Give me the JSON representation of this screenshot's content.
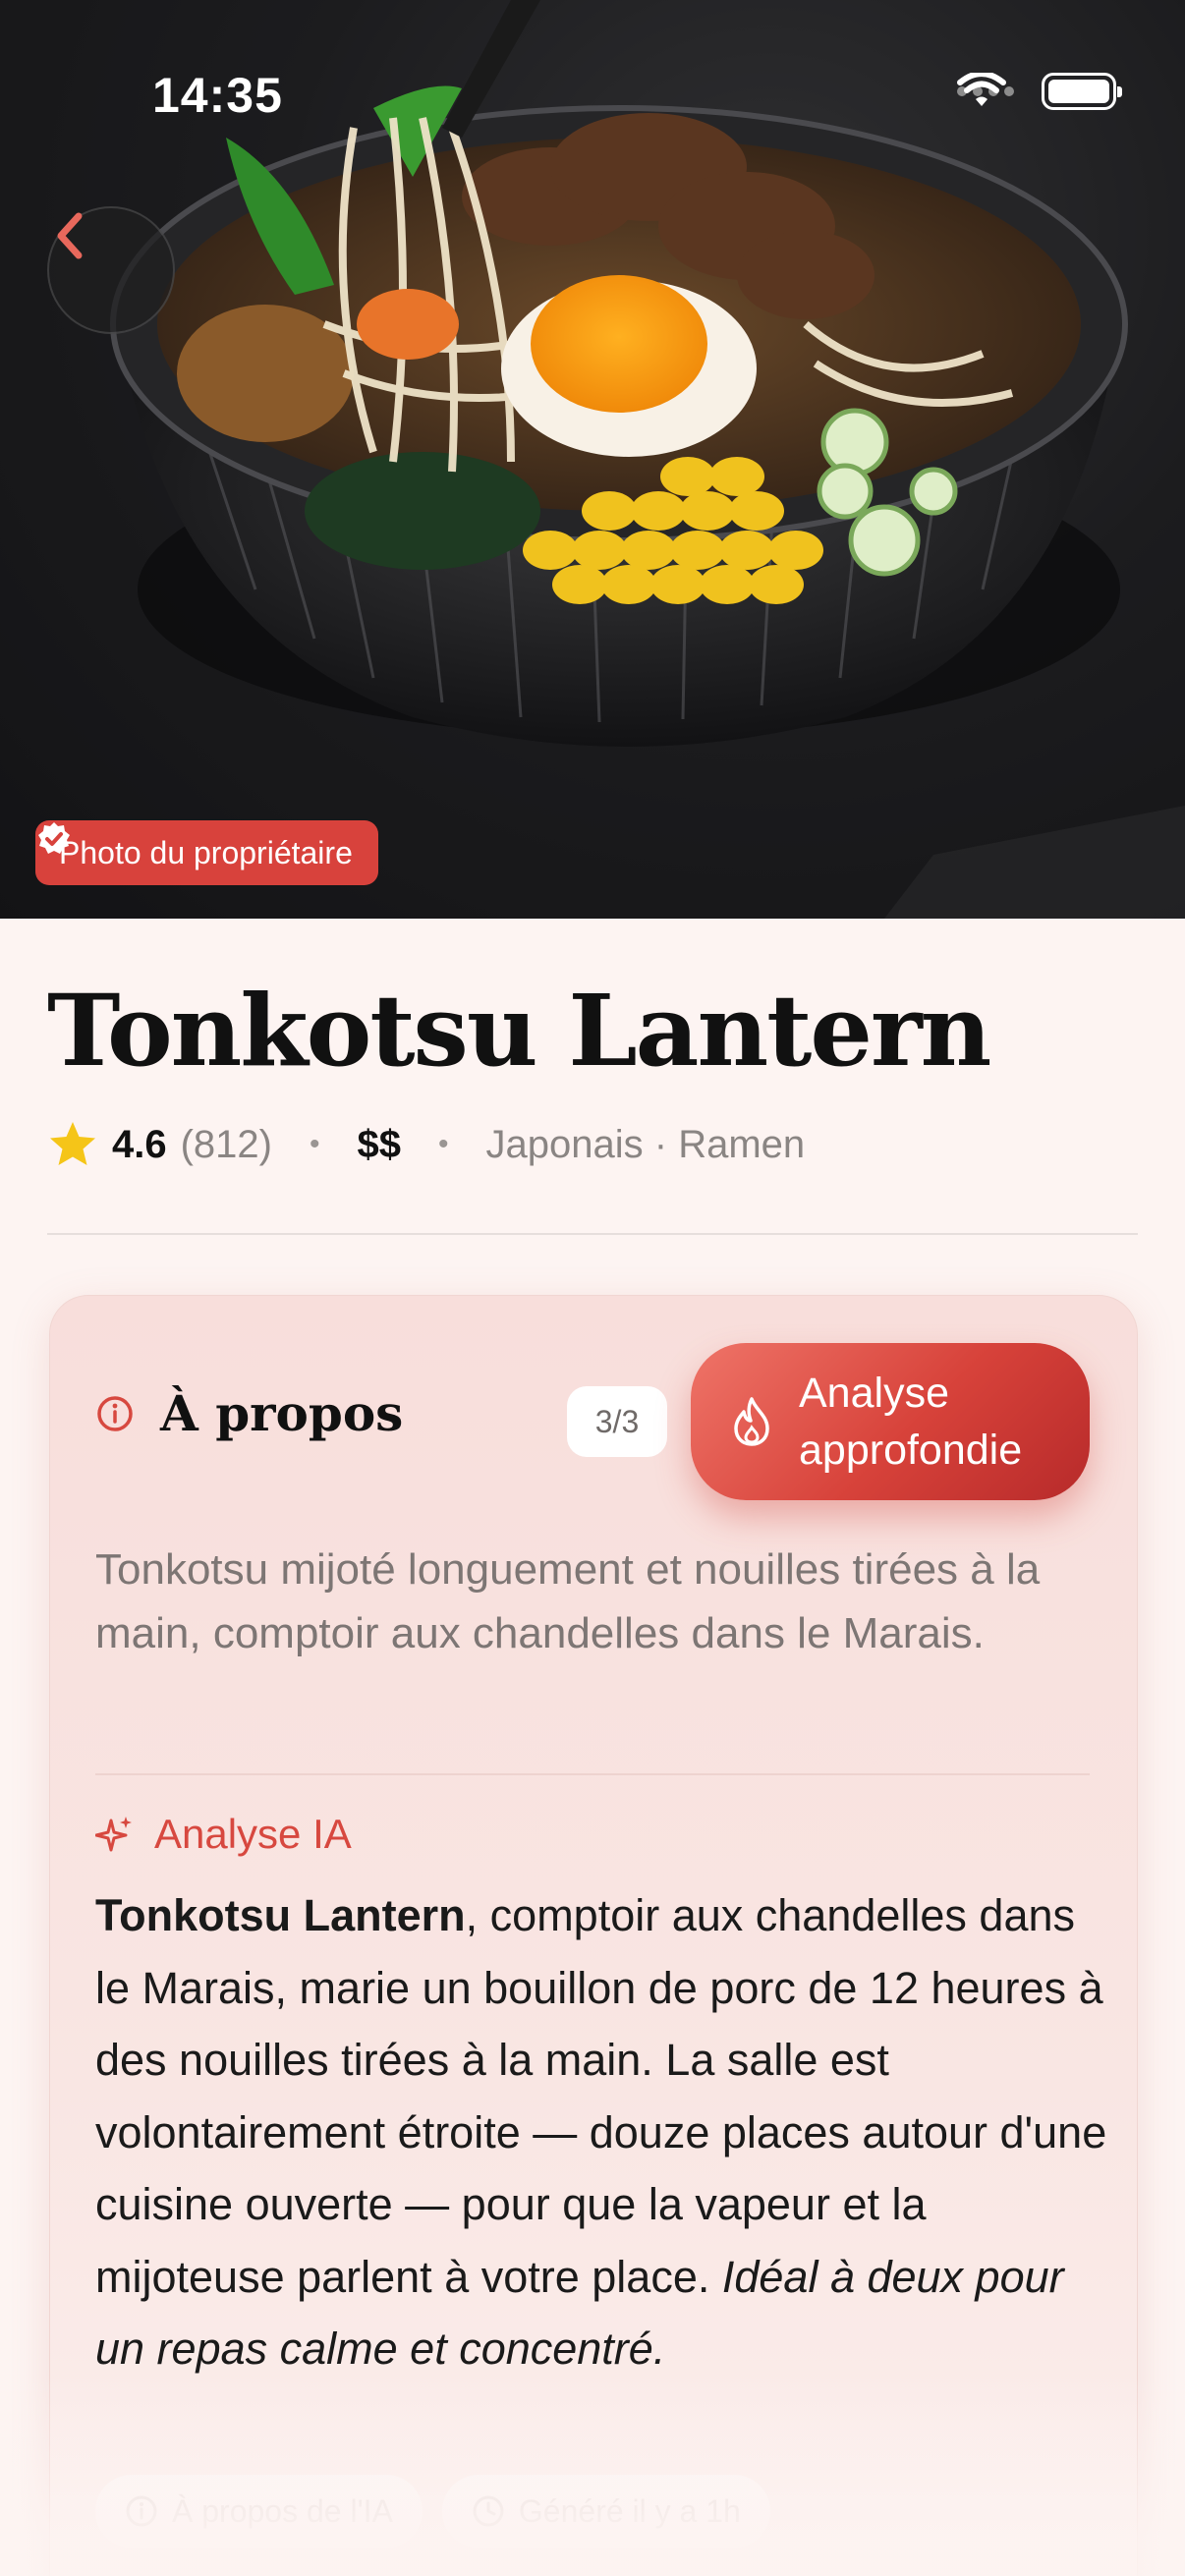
{
  "status_bar": {
    "time": "14:35"
  },
  "hero": {
    "photo_badge": "Photo du propriétaire"
  },
  "restaurant": {
    "name": "Tonkotsu Lantern",
    "rating": "4.6",
    "review_count": "(812)",
    "price": "$$",
    "category": "Japonais · Ramen",
    "separator": "•"
  },
  "about_card": {
    "title": "À propos",
    "counter": "3/3",
    "deep_button_line1": "Analyse",
    "deep_button_line2": "approfondie",
    "summary": "Tonkotsu mijoté longuement et nouilles tirées à la main, comptoir aux chandelles dans le Marais.",
    "ai_label": "Analyse IA",
    "ai_text_bold": "Tonkotsu Lantern",
    "ai_text_body": ", comptoir aux chandelles dans le Marais, marie un bouillon de porc de 12 heures à des nouilles tirées à la main. La salle est volontairement étroite — douze places autour d'une cuisine ouverte — pour que la vapeur et la mijoteuse parlent à votre place. ",
    "ai_text_italic": "Idéal à deux pour un repas calme et concentré.",
    "chip_about_ai": "À propos de l'IA",
    "chip_generated": "Généré il y a 1h"
  },
  "colors": {
    "accent": "#d8423c",
    "background": "#fdf4f2",
    "star": "#f5c518"
  },
  "icons": [
    "chevron-left-icon",
    "verified-badge-icon",
    "star-icon",
    "info-icon",
    "flame-icon",
    "sparkle-icon",
    "clock-icon",
    "wifi-icon",
    "battery-icon"
  ]
}
